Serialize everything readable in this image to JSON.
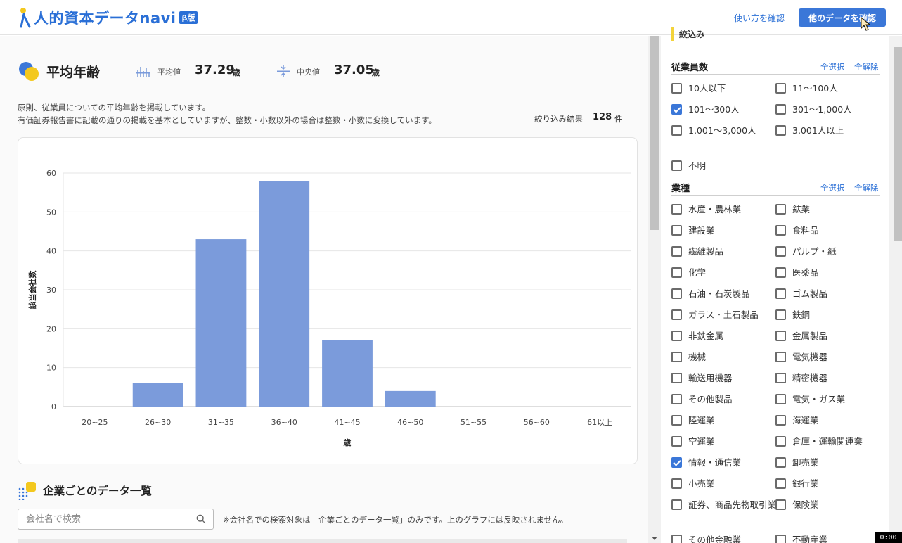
{
  "header": {
    "logo_text": "人的資本データnavi",
    "logo_badge": "β版",
    "help_link": "使い方を確認",
    "other_data_button": "他のデータを確認"
  },
  "summary": {
    "title": "平均年齢",
    "mean_label": "平均値",
    "mean_value": "37.29",
    "median_label": "中央値",
    "median_value": "37.05",
    "unit": "歳",
    "description_1": "原則、従業員についての平均年齢を掲載しています。",
    "description_2": "有価証券報告書に記載の通りの掲載を基本としていますが、整数・小数以外の場合は整数・小数に変換しています。",
    "result_label": "絞り込み結果",
    "result_count": "128",
    "result_unit": "件"
  },
  "chart_data": {
    "type": "bar",
    "categories": [
      "20~25",
      "26~30",
      "31~35",
      "36~40",
      "41~45",
      "46~50",
      "51~55",
      "56~60",
      "61以上"
    ],
    "values": [
      0,
      6,
      43,
      58,
      17,
      4,
      0,
      0,
      0
    ],
    "xlabel": "歳",
    "ylabel": "該当会社数",
    "ylim": [
      0,
      60
    ],
    "yticks": [
      0,
      10,
      20,
      30,
      40,
      50,
      60
    ],
    "grid": true,
    "bar_color": "#7b9bdb"
  },
  "company_list": {
    "title": "企業ごとのデータ一覧",
    "search_placeholder": "会社名で検索",
    "search_note": "※会社名での検索対象は「企業ごとのデータ一覧」のみです。上のグラフには反映されません。"
  },
  "sidebar": {
    "narrow_label": "絞込み",
    "select_all": "全選択",
    "clear_all": "全解除",
    "employees": {
      "title": "従業員数",
      "options": [
        {
          "label": "10人以下",
          "checked": false
        },
        {
          "label": "11～100人",
          "checked": false
        },
        {
          "label": "101～300人",
          "checked": true
        },
        {
          "label": "301～1,000人",
          "checked": false
        },
        {
          "label": "1,001～3,000人",
          "checked": false
        },
        {
          "label": "3,001人以上",
          "checked": false
        },
        {
          "label": "不明",
          "checked": false
        }
      ]
    },
    "industry": {
      "title": "業種",
      "options": [
        {
          "label": "水産・農林業",
          "checked": false
        },
        {
          "label": "鉱業",
          "checked": false
        },
        {
          "label": "建設業",
          "checked": false
        },
        {
          "label": "食料品",
          "checked": false
        },
        {
          "label": "繊維製品",
          "checked": false
        },
        {
          "label": "パルプ・紙",
          "checked": false
        },
        {
          "label": "化学",
          "checked": false
        },
        {
          "label": "医薬品",
          "checked": false
        },
        {
          "label": "石油・石炭製品",
          "checked": false
        },
        {
          "label": "ゴム製品",
          "checked": false
        },
        {
          "label": "ガラス・土石製品",
          "checked": false
        },
        {
          "label": "鉄鋼",
          "checked": false
        },
        {
          "label": "非鉄金属",
          "checked": false
        },
        {
          "label": "金属製品",
          "checked": false
        },
        {
          "label": "機械",
          "checked": false
        },
        {
          "label": "電気機器",
          "checked": false
        },
        {
          "label": "輸送用機器",
          "checked": false
        },
        {
          "label": "精密機器",
          "checked": false
        },
        {
          "label": "その他製品",
          "checked": false
        },
        {
          "label": "電気・ガス業",
          "checked": false
        },
        {
          "label": "陸運業",
          "checked": false
        },
        {
          "label": "海運業",
          "checked": false
        },
        {
          "label": "空運業",
          "checked": false
        },
        {
          "label": "倉庫・運輸関連業",
          "checked": false
        },
        {
          "label": "情報・通信業",
          "checked": true
        },
        {
          "label": "卸売業",
          "checked": false
        },
        {
          "label": "小売業",
          "checked": false
        },
        {
          "label": "銀行業",
          "checked": false
        },
        {
          "label": "証券、商品先物取引業",
          "checked": false
        },
        {
          "label": "保険業",
          "checked": false
        },
        {
          "label": "その他金融業",
          "checked": false
        },
        {
          "label": "不動産業",
          "checked": false
        }
      ]
    }
  },
  "recording_timer": "0:00"
}
